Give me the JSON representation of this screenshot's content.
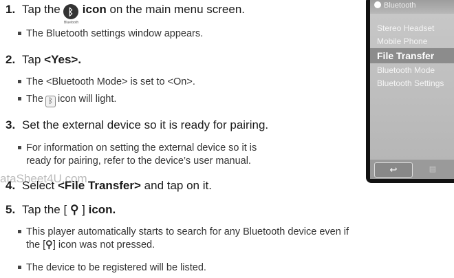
{
  "steps": [
    {
      "num": "1.",
      "pre": "Tap the",
      "bold": "icon",
      "post": " on the main menu screen.",
      "bullets": [
        "The Bluetooth settings window appears."
      ],
      "icon_caption": "Bluetooth"
    },
    {
      "num": "2.",
      "pre": "Tap",
      "bold": "<Yes>.",
      "post": "",
      "bullets": [
        "The <Bluetooth Mode> is set to <On>.",
        "icon will light."
      ],
      "bullet2_pre": "The"
    },
    {
      "num": "3.",
      "text": "Set the external device so it is ready for pairing.",
      "bullets": [
        "For information on setting the external device so it is",
        "ready for pairing, refer to the device’s user manual."
      ]
    },
    {
      "num": "4.",
      "pre": "Select",
      "bold": "<File Transfer>",
      "post": " and tap on it."
    },
    {
      "num": "5.",
      "pre": "Tap the [",
      "post": "]",
      "bold": "icon.",
      "bullets": [
        "This player automatically starts to search for any Bluetooth device even if",
        "the [",
        "] icon was not pressed.",
        "The device to be registered will be listed."
      ]
    }
  ],
  "watermark": "ataSheet4U.com",
  "device_screen": {
    "title": "Bluetooth",
    "menu": [
      "Stereo Headset",
      "Mobile Phone",
      "File Transfer",
      "Bluetooth Mode",
      "Bluetooth Settings"
    ],
    "active_index": 2,
    "back_label": "↩",
    "menu_label": "▤"
  },
  "icons": {
    "bluetooth": "bluetooth-icon",
    "search": "search-icon"
  }
}
